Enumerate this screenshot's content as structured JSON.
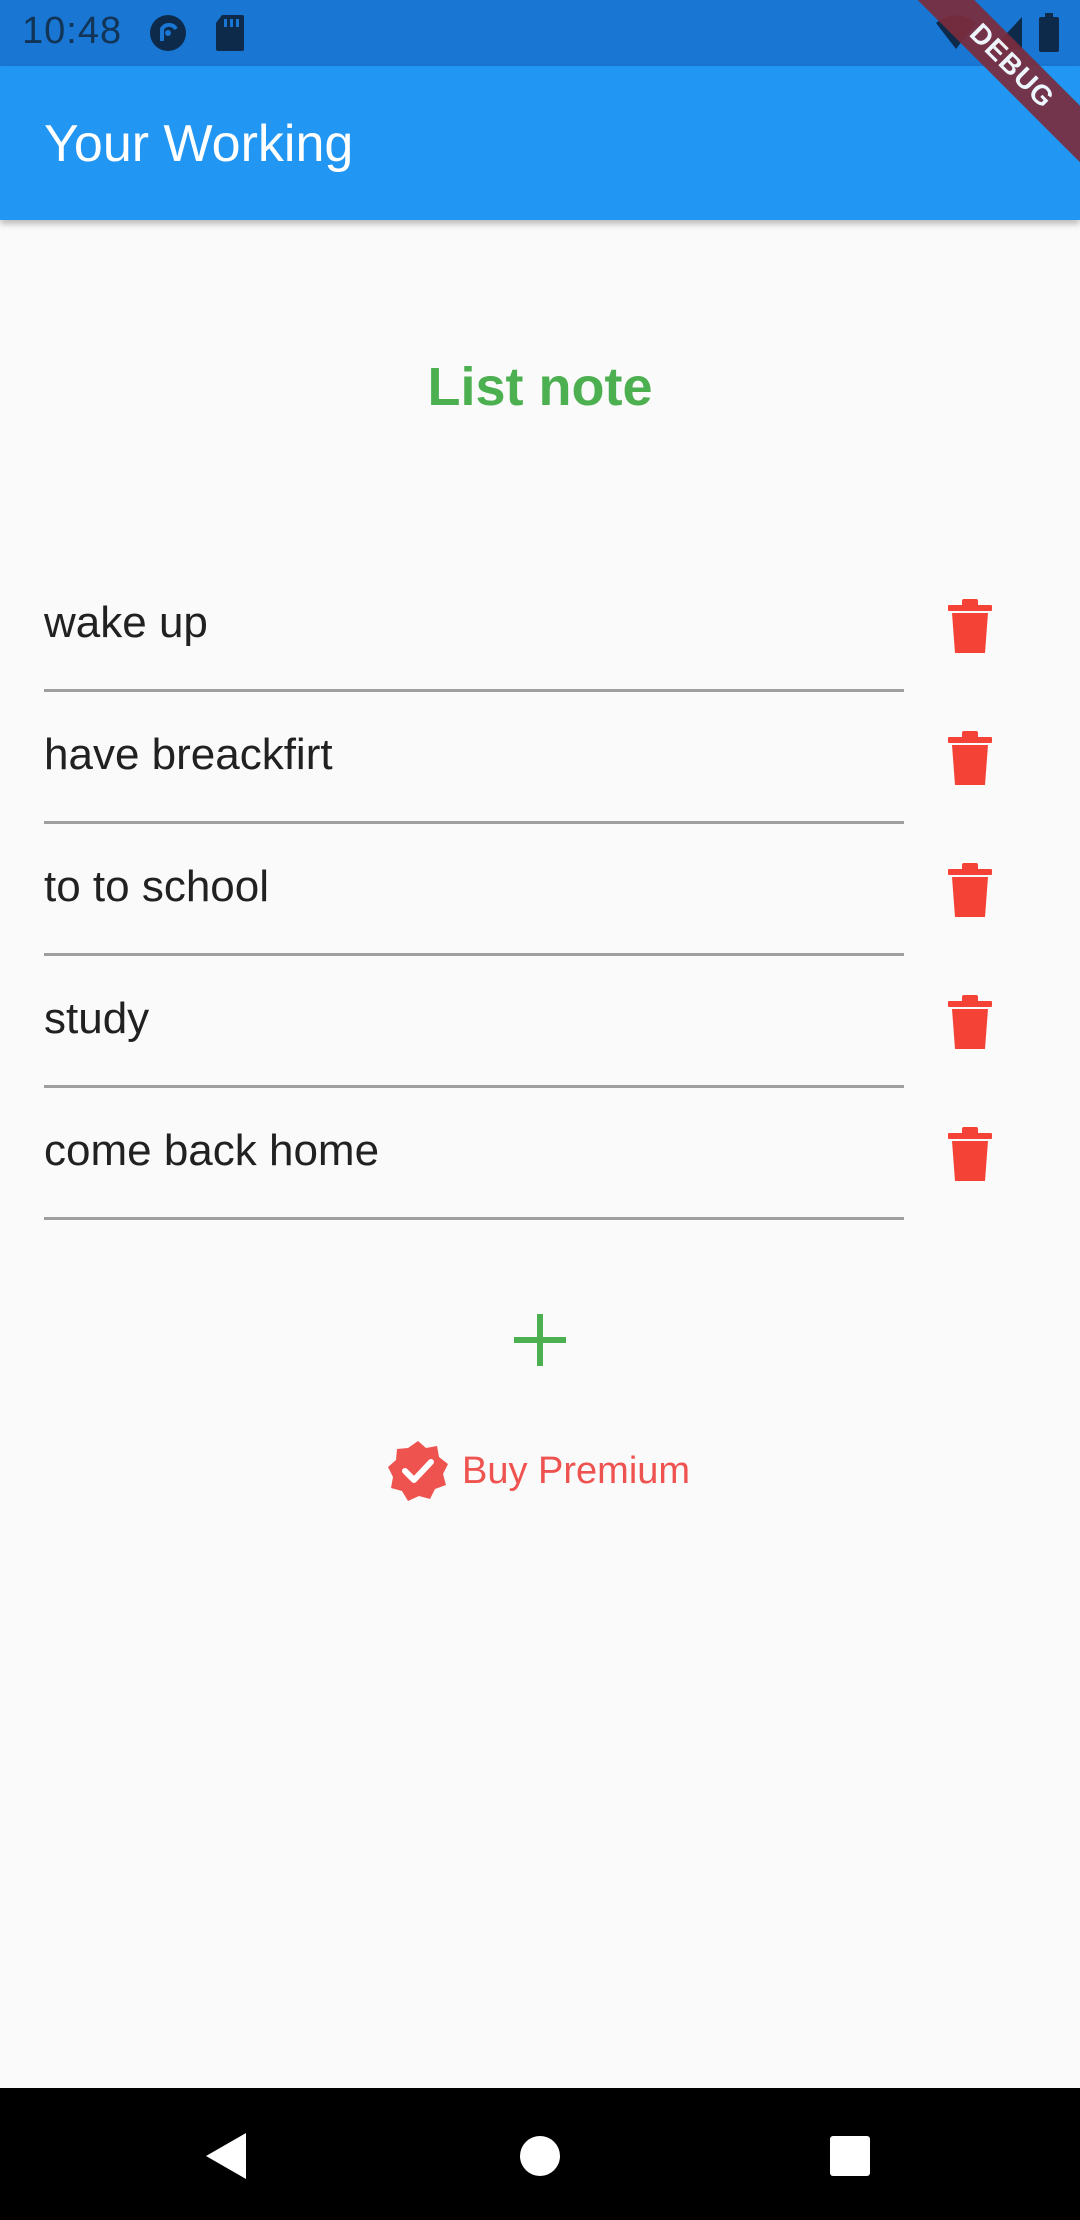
{
  "status_bar": {
    "time": "10:48",
    "icons": [
      "pocket-casts-icon",
      "sd-card-icon",
      "wifi-icon",
      "signal-icon",
      "battery-icon"
    ]
  },
  "debug_banner": "DEBUG",
  "app_bar": {
    "title": "Your Working"
  },
  "heading": "List note",
  "notes": [
    {
      "text": "wake up"
    },
    {
      "text": "have breackfirt"
    },
    {
      "text": "to to school"
    },
    {
      "text": "study"
    },
    {
      "text": "come back home"
    }
  ],
  "premium": {
    "label": "Buy Premium"
  },
  "colors": {
    "app_bar": "#2196f3",
    "status_bar": "#1976d2",
    "heading": "#4caf50",
    "delete": "#f44336",
    "premium": "#ef5350",
    "add": "#4caf50"
  }
}
